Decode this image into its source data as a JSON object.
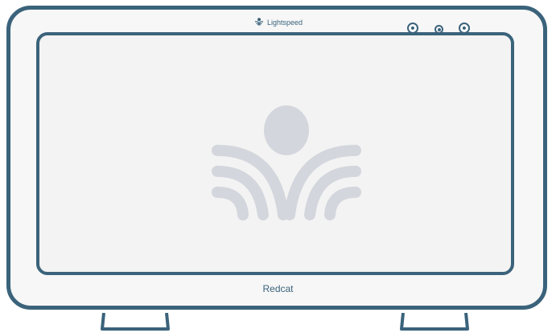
{
  "device": {
    "brand_name": "Lightspeed",
    "product_name": "Redcat",
    "brand_icon": "lightspeed-logo-icon",
    "screen_logo": "lightspeed-person-waves-logo",
    "colors": {
      "frame": "#3b637b",
      "logo": "#d3d6dc",
      "screen_background": "#f3f3f3"
    }
  }
}
